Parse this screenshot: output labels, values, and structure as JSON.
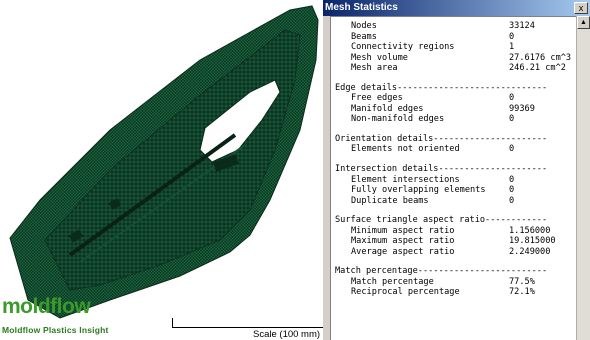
{
  "brand": {
    "logo_text": "moldflow",
    "subtitle": "Moldflow Plastics Insight"
  },
  "viewport": {
    "scale_label": "Scale (100 mm)",
    "mesh_color": "#0e3d26",
    "line_color": "#1f6b46"
  },
  "dialog": {
    "title": "Mesh Statistics",
    "close_glyph": "x"
  },
  "report": {
    "general": [
      {
        "label": "Nodes",
        "value": "33124"
      },
      {
        "label": "Beams",
        "value": "0"
      },
      {
        "label": "Connectivity regions",
        "value": "1"
      },
      {
        "label": "Mesh volume",
        "value": "27.6176 cm^3"
      },
      {
        "label": "Mesh area",
        "value": "246.21 cm^2"
      }
    ],
    "sections": [
      {
        "heading": "Edge details-----------------------------",
        "items": [
          {
            "label": "Free edges",
            "value": "0"
          },
          {
            "label": "Manifold edges",
            "value": "99369"
          },
          {
            "label": "Non-manifold edges",
            "value": "0"
          }
        ]
      },
      {
        "heading": "Orientation details----------------------",
        "items": [
          {
            "label": "Elements not oriented",
            "value": "0"
          }
        ]
      },
      {
        "heading": "Intersection details---------------------",
        "items": [
          {
            "label": "Element intersections",
            "value": "0"
          },
          {
            "label": "Fully overlapping elements",
            "value": "0"
          },
          {
            "label": "Duplicate beams",
            "value": "0"
          }
        ]
      },
      {
        "heading": "Surface triangle aspect ratio------------",
        "items": [
          {
            "label": "Minimum aspect ratio",
            "value": "1.156000"
          },
          {
            "label": "Maximum aspect ratio",
            "value": "19.815000"
          },
          {
            "label": "Average aspect ratio",
            "value": "2.249000"
          }
        ]
      },
      {
        "heading": "Match percentage-------------------------",
        "items": [
          {
            "label": "Match percentage",
            "value": "77.5%"
          },
          {
            "label": "Reciprocal percentage",
            "value": "72.1%"
          }
        ]
      }
    ]
  }
}
